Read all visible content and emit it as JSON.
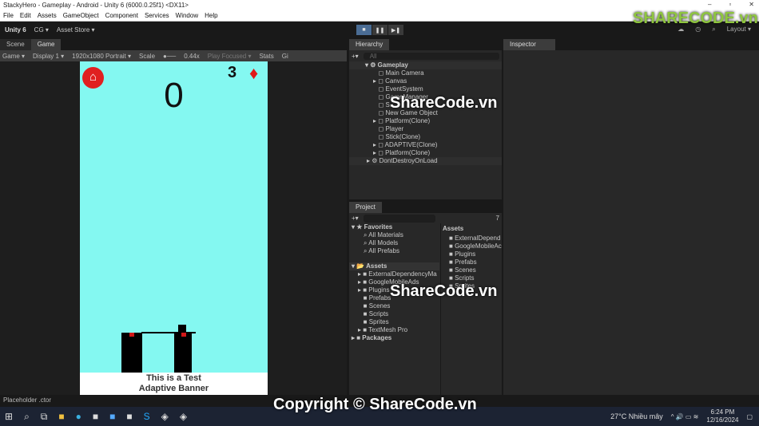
{
  "window": {
    "title": "StackyHero - Gameplay - Android - Unity 6 (6000.0.25f1) <DX11>"
  },
  "menu": [
    "File",
    "Edit",
    "Assets",
    "GameObject",
    "Component",
    "Services",
    "Window",
    "Help"
  ],
  "toolbar": {
    "unity": "Unity 6",
    "account": "CG ▾",
    "store": "Asset Store ▾",
    "layout": "Layout ▾"
  },
  "tabs": {
    "scene": "Scene",
    "game": "Game",
    "hierarchy": "Hierarchy",
    "project": "Project",
    "inspector": "Inspector"
  },
  "game_toolbar": {
    "mode": "Game ▾",
    "display": "Display 1 ▾",
    "resolution": "1920x1080 Portrait ▾",
    "scale_label": "Scale",
    "scale": "0.44x",
    "play": "Play Focused ▾",
    "stats": "Stats",
    "gizmos": "Gi"
  },
  "game": {
    "score": "0",
    "gems": "3",
    "banner_line1": "This is a Test",
    "banner_line2": "Adaptive Banner"
  },
  "hierarchy": {
    "search": "All",
    "scene": "Gameplay",
    "items": [
      {
        "label": "Main Camera",
        "expand": false
      },
      {
        "label": "Canvas",
        "expand": true
      },
      {
        "label": "EventSystem",
        "expand": false
      },
      {
        "label": "GameManager",
        "expand": false
      },
      {
        "label": "S...",
        "expand": false
      },
      {
        "label": "New Game Object",
        "expand": false
      },
      {
        "label": "Platform(Clone)",
        "expand": true
      },
      {
        "label": "Player",
        "expand": false
      },
      {
        "label": "Stick(Clone)",
        "expand": false
      },
      {
        "label": "ADAPTIVE(Clone)",
        "expand": true
      },
      {
        "label": "Platform(Clone)",
        "expand": true
      }
    ],
    "dontdestroy": "DontDestroyOnLoad"
  },
  "project": {
    "hidden_count": "7",
    "favorites": "Favorites",
    "fav_items": [
      "All Materials",
      "All Models",
      "All Prefabs"
    ],
    "assets": "Assets",
    "tree": [
      "ExternalDependencyMa",
      "GoogleMobileAds",
      "Plugins",
      "Prefabs",
      "Scenes",
      "Scripts",
      "Sprites",
      "TextMesh Pro"
    ],
    "packages": "Packages",
    "right_header": "Assets",
    "right_items": [
      "ExternalDepend",
      "GoogleMobileAc",
      "Plugins",
      "Prefabs",
      "Scenes",
      "Scripts",
      "Sprites"
    ]
  },
  "status": {
    "text": "Placeholder .ctor"
  },
  "taskbar": {
    "weather": "27°C  Nhiều mây",
    "time": "6:24 PM",
    "date": "12/16/2024"
  },
  "watermark": {
    "logo": "SHARECODE.vn",
    "mid": "ShareCode.vn",
    "bottom": "Copyright © ShareCode.vn"
  }
}
